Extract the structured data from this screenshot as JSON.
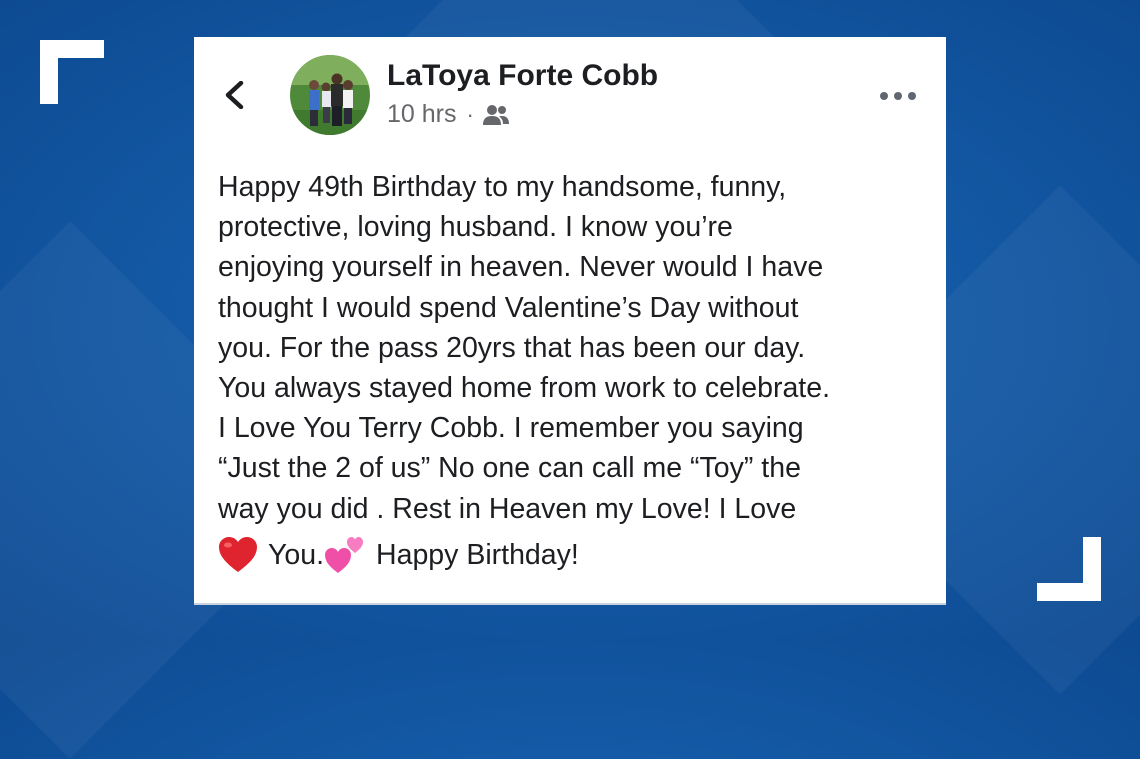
{
  "post": {
    "author": "LaToya Forte Cobb",
    "timestamp": "10 hrs",
    "separator": "·",
    "audience_icon": "friends-icon",
    "lines": [
      "Happy 49th Birthday to my handsome, funny,",
      "protective, loving husband.  I know you’re",
      "enjoying yourself in heaven.  Never would I have",
      "thought I would spend Valentine’s Day without",
      "you.  For the pass 20yrs that has been our day.",
      "You always stayed home from work to celebrate.",
      "I Love You Terry Cobb.  I remember you saying",
      "“Just the 2 of us” No one can call me “Toy” the",
      "way you did .  Rest in Heaven my Love! I Love"
    ],
    "closing_you": "You.",
    "closing_text": "Happy Birthday!"
  },
  "colors": {
    "background": "#145aa6",
    "card": "#ffffff",
    "text": "#1c1e21",
    "meta": "#65676b",
    "heart_red": "#e0242f",
    "heart_pink": "#f04fa8"
  },
  "icons": [
    "back-arrow-icon",
    "more-options-icon",
    "friends-icon",
    "red-heart-emoji",
    "two-hearts-emoji"
  ]
}
